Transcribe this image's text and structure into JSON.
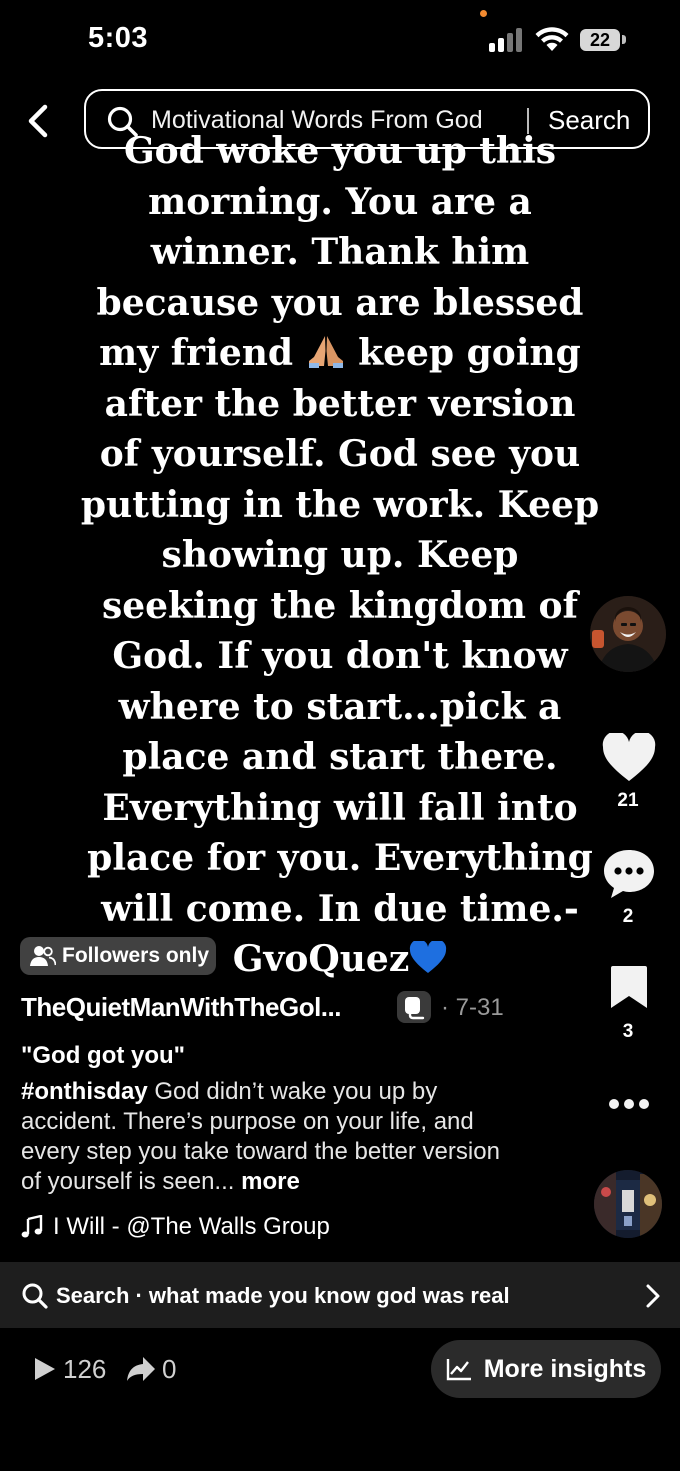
{
  "status_bar": {
    "time": "5:03",
    "battery": "22",
    "indicator_color": "#f28a30"
  },
  "search": {
    "query": "Motivational Words From God",
    "button_label": "Search"
  },
  "post": {
    "quote_text": "God woke you up this morning. You are a winner. Thank him because you are blessed my friend 🙏 keep going after the better version of yourself. God see you putting in the work. Keep showing up. Keep seeking the kingdom of God. If you don't know where to start...pick a place and start there. Everything will fall into place for you. Everything will come. In due time.-GvoQuez💙",
    "quote_part_1": "God woke you up this morning. You are a winner. Thank him because you are blessed my friend",
    "quote_part_2": "keep going after the better version of yourself. God see you putting in the work. Keep showing up. Keep seeking the kingdom of God. If you don't know where to start...pick a place and start there. Everything will fall into place for you. Everything will come. In due time.-GvoQuez",
    "praying_hands_emoji": "🙏",
    "blue_heart_emoji": "💙",
    "audience_badge": "Followers only",
    "username": "TheQuietManWithTheGol...",
    "date": "· 7-31",
    "caption_title": "\"God got you\"",
    "caption_hashtag": "#onthisday",
    "caption_text": "God didn’t wake you up by accident. There’s purpose on your life, and every step you take toward the better version of yourself is seen...",
    "more_label": "more",
    "music": "I Will - @The Walls Group"
  },
  "actions": {
    "likes": "21",
    "comments": "2",
    "saves": "3"
  },
  "related_search": {
    "label": "Search · what made you know god was real"
  },
  "stats": {
    "plays": "126",
    "shares": "0",
    "insights_label": "More insights"
  },
  "colors": {
    "background": "#000000",
    "blue_heart": "#1e6fe0",
    "related_bar": "#1e1e1e",
    "insights_button": "#2b2b2b"
  }
}
